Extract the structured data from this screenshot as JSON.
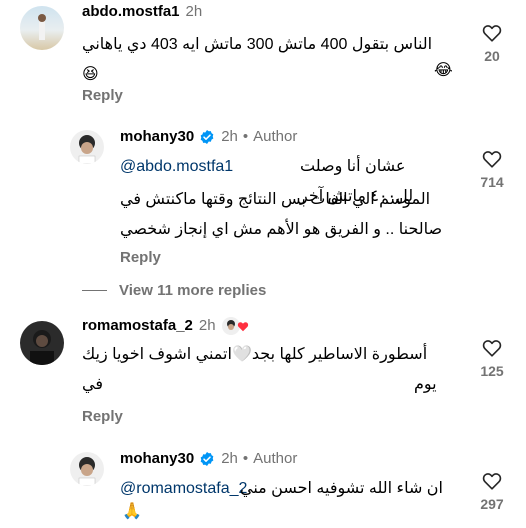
{
  "comments": [
    {
      "username": "abdo.mostfa1",
      "time": "2h",
      "text": "الناس بتقول 400 ماتش 300 ماتش ايه 403 دي ياهاني 😆",
      "text2": "😂",
      "likes": "20",
      "reply_label": "Reply"
    },
    {
      "username": "mohany30",
      "time": "2h",
      "author_label": "Author",
      "mention": "@abdo.mostfa1",
      "text_after_mention": " عشان أنا وصلت لل٤٠٠ ماتش آخر",
      "text_line2": "الموسم الي الفات بس النتائج وقتها ماكنتش في",
      "text_line3": "صالحنا .. و الفريق هو الأهم مش اي إنجاز شخصي",
      "likes": "714",
      "reply_label": "Reply"
    },
    {
      "username": "romamostafa_2",
      "time": "2h",
      "text": "أسطورة الاساطير كلها بجد🤍اتمني اشوف اخويا زيك في",
      "text2": "يوم",
      "likes": "125",
      "reply_label": "Reply"
    },
    {
      "username": "mohany30",
      "time": "2h",
      "author_label": "Author",
      "mention": "@romamostafa_2",
      "text_line2": "ان شاء الله تشوفيه احسن مني",
      "text_line3": "🙏",
      "likes": "297"
    }
  ],
  "view_more_label": "View 11 more replies",
  "colors": {
    "secondary_text": "#737373",
    "mention": "#00376b",
    "verified": "#0095f6",
    "heart_red": "#ff3040"
  }
}
